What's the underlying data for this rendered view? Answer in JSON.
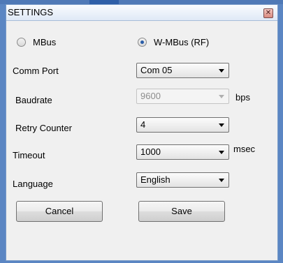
{
  "window": {
    "title": "SETTINGS",
    "close_icon": "close-icon"
  },
  "mode": {
    "options": [
      {
        "label": "MBus",
        "selected": false
      },
      {
        "label": "W-MBus (RF)",
        "selected": true
      }
    ]
  },
  "fields": {
    "comm_port": {
      "label": "Comm Port",
      "value": "Com 05"
    },
    "baudrate": {
      "label": "Baudrate",
      "value": "9600",
      "unit": "bps",
      "enabled": false
    },
    "retry_counter": {
      "label": "Retry Counter",
      "value": "4"
    },
    "timeout": {
      "label": "Timeout",
      "value": "1000",
      "unit": "msec"
    },
    "language": {
      "label": "Language",
      "value": "English"
    }
  },
  "buttons": {
    "cancel": "Cancel",
    "save": "Save"
  },
  "colors": {
    "selected_radio": "#2a5da8",
    "frame": "#5b86c3"
  }
}
